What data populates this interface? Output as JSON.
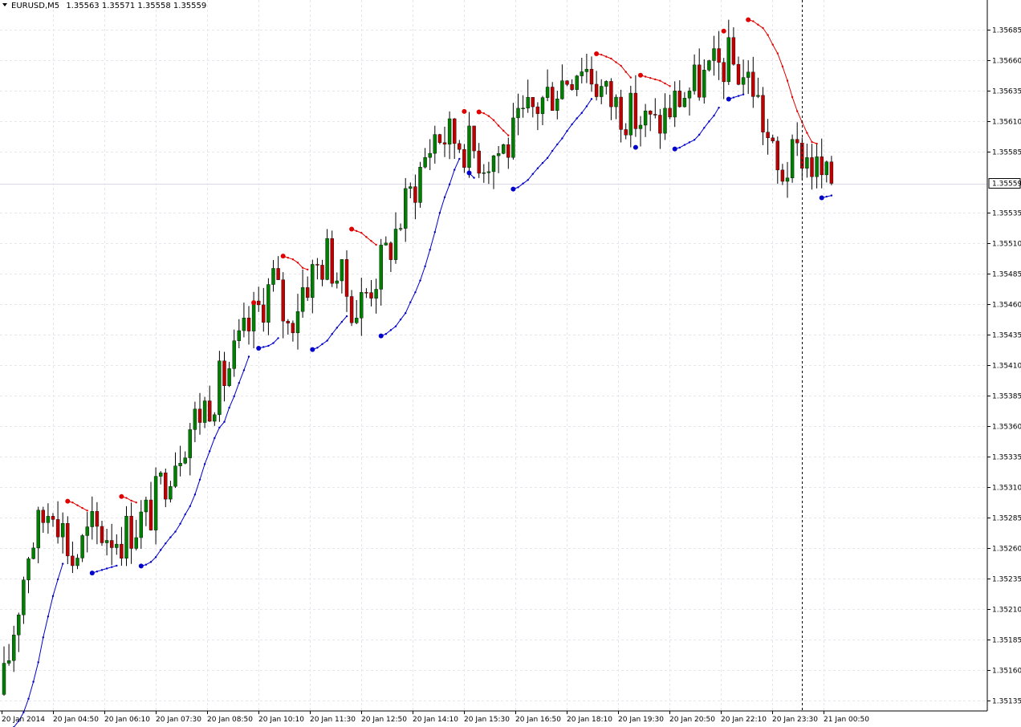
{
  "header": {
    "symbol_label": "EURUSD,M5",
    "ohlc": "1.35563 1.35571 1.35558 1.35559"
  },
  "colors": {
    "bull": "#008000",
    "bear": "#c00000",
    "psar_up": "#0000cc",
    "psar_down": "#e00000",
    "grid": "#e6e6ec",
    "axis": "#000000"
  },
  "price_axis": {
    "ticks": [
      "1.35685",
      "1.35660",
      "1.35635",
      "1.35610",
      "1.35585",
      "1.35559",
      "1.35535",
      "1.35510",
      "1.35485",
      "1.35460",
      "1.35435",
      "1.35410",
      "1.35385",
      "1.35360",
      "1.35335",
      "1.35310",
      "1.35285",
      "1.35260",
      "1.35235",
      "1.35210",
      "1.35185",
      "1.35160",
      "1.35135"
    ],
    "current_price": "1.35559"
  },
  "time_axis": {
    "ticks": [
      "20 Jan 2014",
      "20 Jan 04:50",
      "20 Jan 06:10",
      "20 Jan 07:30",
      "20 Jan 08:50",
      "20 Jan 10:10",
      "20 Jan 11:30",
      "20 Jan 12:50",
      "20 Jan 14:10",
      "20 Jan 15:30",
      "20 Jan 16:50",
      "20 Jan 18:10",
      "20 Jan 19:30",
      "20 Jan 20:50",
      "20 Jan 22:10",
      "20 Jan 23:30",
      "21 Jan 00:50"
    ]
  },
  "chart_data": {
    "type": "candlestick",
    "symbol": "EURUSD",
    "timeframe": "M5",
    "ylim": [
      1.3512,
      1.357
    ],
    "bars": 170,
    "indicator": "Parabolic SAR",
    "close_path": [
      [
        0,
        1.3515
      ],
      [
        5,
        1.3526
      ],
      [
        10,
        1.353
      ],
      [
        14,
        1.3525
      ],
      [
        18,
        1.35275
      ],
      [
        24,
        1.3527
      ],
      [
        30,
        1.3529
      ],
      [
        34,
        1.3533
      ],
      [
        38,
        1.3536
      ],
      [
        45,
        1.354
      ],
      [
        50,
        1.3544
      ],
      [
        55,
        1.3548
      ],
      [
        58,
        1.3544
      ],
      [
        61,
        1.35475
      ],
      [
        66,
        1.355
      ],
      [
        72,
        1.35455
      ],
      [
        78,
        1.355
      ],
      [
        83,
        1.3555
      ],
      [
        88,
        1.356
      ],
      [
        93,
        1.35595
      ],
      [
        98,
        1.3558
      ],
      [
        103,
        1.3559
      ],
      [
        107,
        1.35615
      ],
      [
        113,
        1.3564
      ],
      [
        118,
        1.3566
      ],
      [
        123,
        1.3563
      ],
      [
        128,
        1.35615
      ],
      [
        133,
        1.35605
      ],
      [
        138,
        1.3563
      ],
      [
        143,
        1.35645
      ],
      [
        148,
        1.3566
      ],
      [
        153,
        1.3564
      ],
      [
        158,
        1.35565
      ],
      [
        163,
        1.35585
      ],
      [
        168,
        1.35559
      ]
    ],
    "current_price": 1.35559,
    "cursor_bar": 163
  }
}
